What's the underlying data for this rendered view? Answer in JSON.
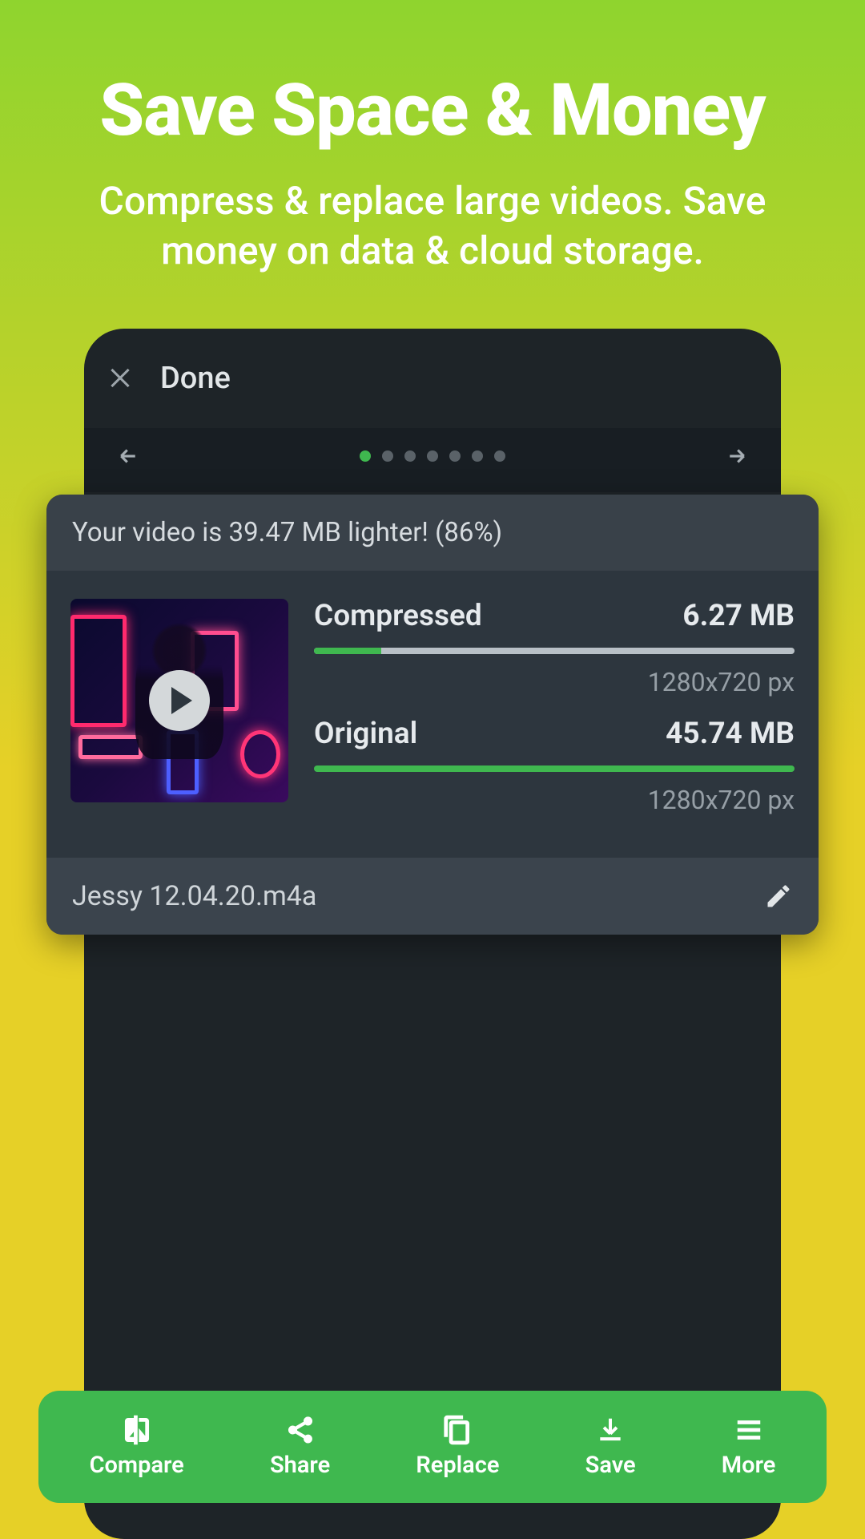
{
  "hero": {
    "title": "Save Space & Money",
    "subtitle": "Compress & replace large videos. Save money on data &  cloud storage."
  },
  "header": {
    "done_label": "Done"
  },
  "pagination": {
    "total": 7,
    "active_index": 0
  },
  "result": {
    "banner": "Your video is 39.47 MB lighter! (86%)",
    "compressed": {
      "label": "Compressed",
      "size": "6.27 MB",
      "resolution": "1280x720 px",
      "progress_percent": 14
    },
    "original": {
      "label": "Original",
      "size": "45.74 MB",
      "resolution": "1280x720 px",
      "progress_percent": 100
    },
    "filename": "Jessy 12.04.20.m4a"
  },
  "bottom_actions": {
    "compare": "Compare",
    "share": "Share",
    "replace": "Replace",
    "save": "Save",
    "more": "More"
  },
  "colors": {
    "accent_green": "#3fb84f",
    "bg_dark": "#1e2428",
    "card": "#2d363e"
  }
}
